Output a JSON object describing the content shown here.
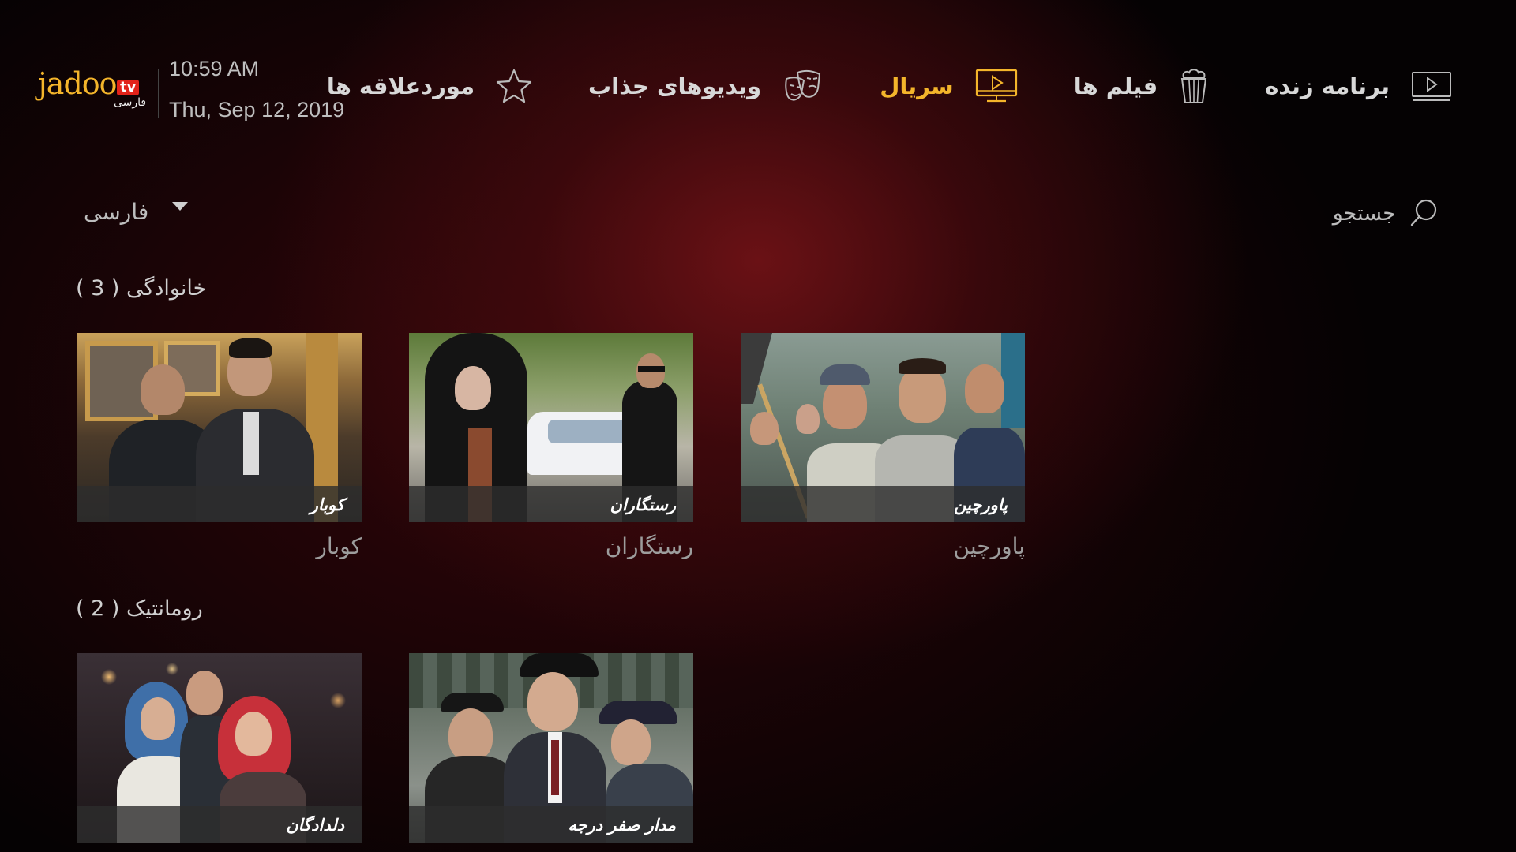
{
  "header": {
    "logo": {
      "brand": "jadoo",
      "tv_badge": "tv",
      "language_tag": "فارسی"
    },
    "time": "10:59 AM",
    "date": "Thu, Sep 12, 2019"
  },
  "nav": [
    {
      "label": "موردعلاقه ها",
      "icon": "star-icon",
      "active": false
    },
    {
      "label": "ویدیوهای جذاب",
      "icon": "theater-masks-icon",
      "active": false
    },
    {
      "label": "سریال",
      "icon": "tv-series-icon",
      "active": true
    },
    {
      "label": "فیلم ها",
      "icon": "popcorn-icon",
      "active": false
    },
    {
      "label": "برنامه زنده",
      "icon": "live-play-icon",
      "active": false
    }
  ],
  "colors": {
    "accent": "#f4b52b",
    "background": "#050203",
    "tv_badge": "#e2231a"
  },
  "search": {
    "label": "جستجو",
    "icon": "search-icon"
  },
  "language_select": {
    "value": "فارسی"
  },
  "sections": [
    {
      "title": "خانوادگی ( 3 )",
      "items": [
        {
          "overlay": "پاورچین",
          "caption": "پاورچین"
        },
        {
          "overlay": "رستگاران",
          "caption": "رستگاران"
        },
        {
          "overlay": "کوبار",
          "caption": "کوبار"
        }
      ]
    },
    {
      "title": "رومانتیک ( 2 )",
      "items": [
        {
          "overlay": "مدار صفر درجه"
        },
        {
          "overlay": "دلدادگان"
        }
      ]
    }
  ]
}
